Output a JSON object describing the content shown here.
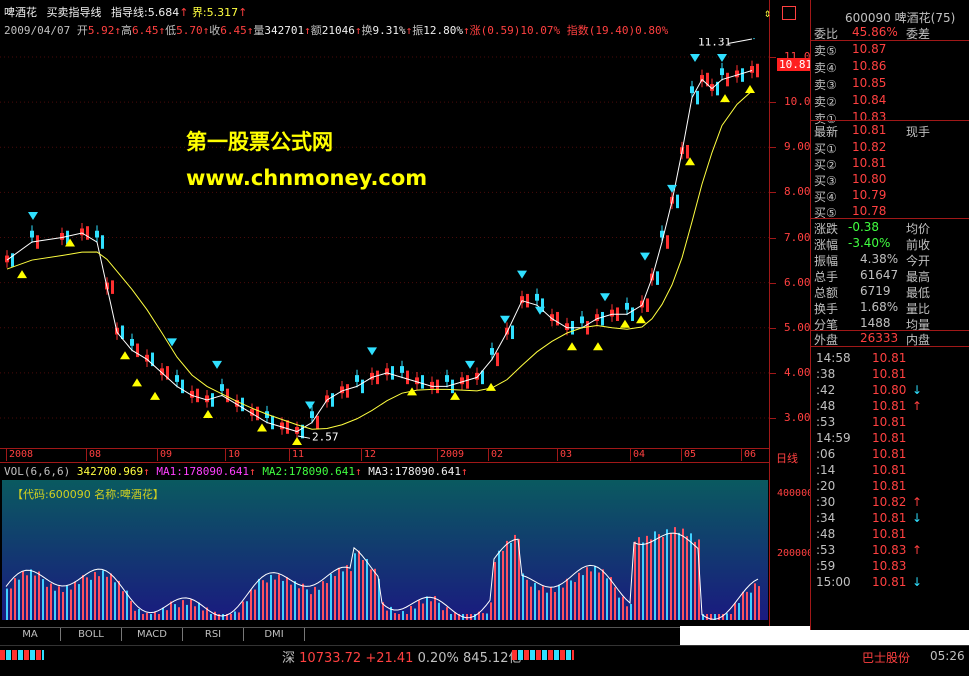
{
  "header": {
    "stock_name": "啤酒花",
    "indicator_name": "买卖指导线",
    "indicator_label": "指导线:",
    "indicator_value": "5.684",
    "bound_label": "界:",
    "bound_value": "5.317",
    "date": "2009/04/07",
    "open_label": "开",
    "open": "5.92",
    "high_label": "高",
    "high": "6.45",
    "low_label": "低",
    "low": "5.70",
    "close_label": "收",
    "close": "6.45",
    "volume_label": "量",
    "volume": "342701",
    "amount_label": "额",
    "amount": "21046",
    "turnover_label": "换",
    "turnover": "9.31%",
    "amplitude_label": "振",
    "amplitude": "12.80%",
    "change_label": "涨",
    "change": "(0.59)10.07%",
    "index_label": "指数",
    "index": "(19.40)0.80%"
  },
  "watermark": {
    "line1": "第一股票公式网",
    "line2": "www.chnmoney.com"
  },
  "price_axis": [
    "11.00",
    "10.00",
    "9.00",
    "8.00",
    "7.00",
    "6.00",
    "5.00",
    "4.00",
    "3.00"
  ],
  "price_tag": "10.81",
  "annotations": {
    "high": "11.31",
    "low": "2.57"
  },
  "x_axis": [
    "2008",
    "08",
    "09",
    "10",
    "11",
    "12",
    "2009",
    "02",
    "03",
    "04",
    "05",
    "06"
  ],
  "period_label": "日线",
  "volume_header": {
    "vol": "VOL(6,6,6)",
    "vol_value": "342700.969",
    "ma1": "MA1:178090.641",
    "ma2": "MA2:178090.641",
    "ma3": "MA3:178090.641"
  },
  "code_label": "【代码:600090 名称:啤酒花】",
  "volume_axis": [
    "400000",
    "200000"
  ],
  "tabs": [
    "MA",
    "BOLL",
    "MACD",
    "RSI",
    "DMI"
  ],
  "right_panel": {
    "code": "600090",
    "name": "啤酒花(75)",
    "weibi_label": "委比",
    "weibi": "45.86%",
    "weicha_label": "委差",
    "asks": [
      {
        "label": "卖⑤",
        "price": "10.87"
      },
      {
        "label": "卖④",
        "price": "10.86"
      },
      {
        "label": "卖③",
        "price": "10.85"
      },
      {
        "label": "卖②",
        "price": "10.84"
      },
      {
        "label": "卖①",
        "price": "10.83"
      }
    ],
    "latest_label": "最新",
    "latest": "10.81",
    "xianshou_label": "现手",
    "bids": [
      {
        "label": "买①",
        "price": "10.82"
      },
      {
        "label": "买②",
        "price": "10.81"
      },
      {
        "label": "买③",
        "price": "10.80"
      },
      {
        "label": "买④",
        "price": "10.79"
      },
      {
        "label": "买⑤",
        "price": "10.78"
      }
    ],
    "stats": [
      {
        "l1": "涨跌",
        "v1": "-0.38",
        "l2": "均价"
      },
      {
        "l1": "涨幅",
        "v1": "-3.40%",
        "l2": "前收"
      },
      {
        "l1": "振幅",
        "v1": "4.38%",
        "l2": "今开"
      },
      {
        "l1": "总手",
        "v1": "61647",
        "l2": "最高"
      },
      {
        "l1": "总额",
        "v1": "6719",
        "l2": "最低"
      },
      {
        "l1": "换手",
        "v1": "1.68%",
        "l2": "量比"
      },
      {
        "l1": "分笔",
        "v1": "1488",
        "l2": "均量"
      }
    ],
    "waipan_label": "外盘",
    "waipan": "26333",
    "neipan_label": "内盘",
    "ticks": [
      {
        "t": "14:58",
        "p": "10.81",
        "a": ""
      },
      {
        "t": ":38",
        "p": "10.81",
        "a": ""
      },
      {
        "t": ":42",
        "p": "10.80",
        "a": "↓"
      },
      {
        "t": ":48",
        "p": "10.81",
        "a": "↑"
      },
      {
        "t": ":53",
        "p": "10.81",
        "a": ""
      },
      {
        "t": "14:59",
        "p": "10.81",
        "a": ""
      },
      {
        "t": ":06",
        "p": "10.81",
        "a": ""
      },
      {
        "t": ":14",
        "p": "10.81",
        "a": ""
      },
      {
        "t": ":20",
        "p": "10.81",
        "a": ""
      },
      {
        "t": ":30",
        "p": "10.82",
        "a": "↑"
      },
      {
        "t": ":34",
        "p": "10.81",
        "a": "↓"
      },
      {
        "t": ":48",
        "p": "10.81",
        "a": ""
      },
      {
        "t": ":53",
        "p": "10.83",
        "a": "↑"
      },
      {
        "t": ":59",
        "p": "10.83",
        "a": ""
      },
      {
        "t": "15:00",
        "p": "10.81",
        "a": "↓"
      }
    ]
  },
  "status_bar": {
    "market": "深",
    "index": "10733.72",
    "change": "+21.41",
    "pct": "0.20%",
    "amount": "845.12亿",
    "ticker_name": "巴士股份",
    "clock": "05:26"
  },
  "colors": {
    "up": "#ff3030",
    "down": "#30e0ff",
    "ma_white": "#ffffff",
    "ma_yellow": "#ffff40"
  }
}
